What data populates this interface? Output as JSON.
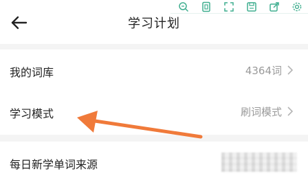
{
  "header": {
    "title": "学习计划",
    "back_icon": "arrow-left-icon"
  },
  "toolbar": {
    "icons": [
      "zoom-icon",
      "fit-page-icon",
      "fullscreen-icon",
      "save-icon",
      "share-icon",
      "settings-icon"
    ],
    "accent_color": "#3fae8f"
  },
  "rows": [
    {
      "label": "我的词库",
      "value": "4364词"
    },
    {
      "label": "学习模式",
      "value": "刷词模式"
    },
    {
      "label": "每日新学单词来源",
      "value": ""
    }
  ],
  "annotation": {
    "color": "#f07a3a"
  }
}
